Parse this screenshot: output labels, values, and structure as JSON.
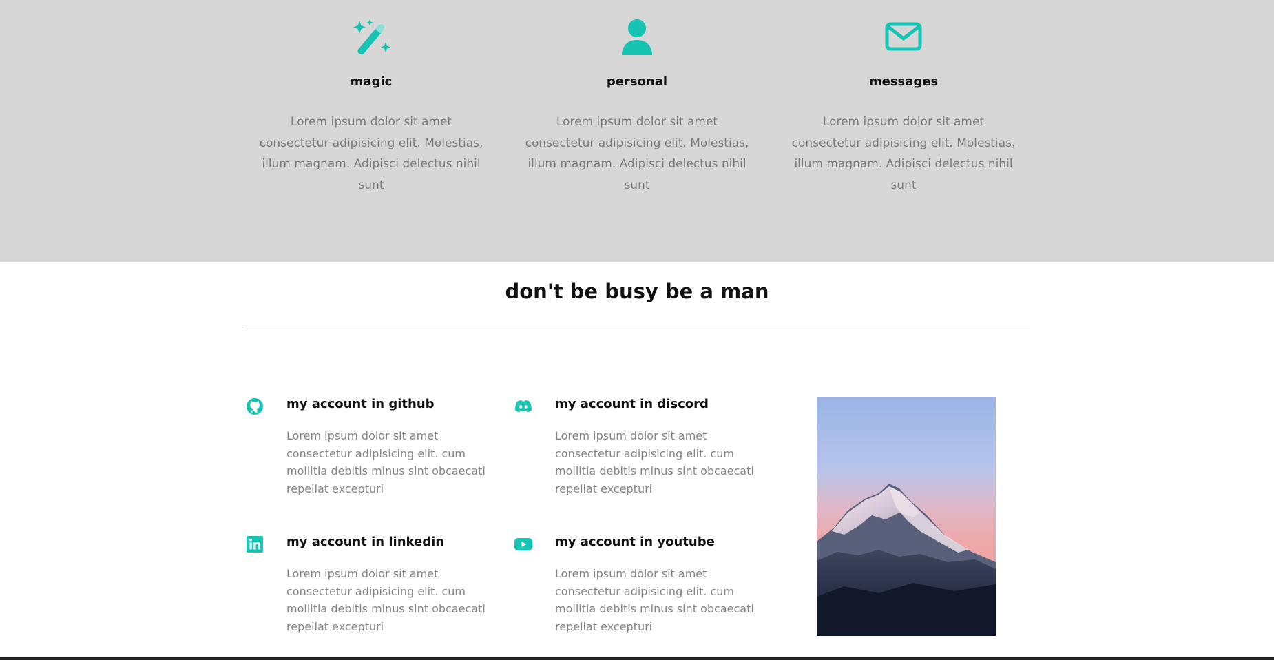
{
  "features": [
    {
      "icon": "magic-wand-icon",
      "title": "magic",
      "text": "Lorem ipsum dolor sit amet consectetur adipisicing elit. Molestias, illum magnam. Adipisci delectus nihil sunt"
    },
    {
      "icon": "user-icon",
      "title": "personal",
      "text": "Lorem ipsum dolor sit amet consectetur adipisicing elit. Molestias, illum magnam. Adipisci delectus nihil sunt"
    },
    {
      "icon": "envelope-icon",
      "title": "messages",
      "text": "Lorem ipsum dolor sit amet consectetur adipisicing elit. Molestias, illum magnam. Adipisci delectus nihil sunt"
    }
  ],
  "section2": {
    "title": "don't be busy be a man"
  },
  "accounts": [
    {
      "icon": "github-icon",
      "title": "my account in github",
      "text": "Lorem ipsum dolor sit amet consectetur adipisicing elit. cum mollitia debitis minus sint obcaecati repellat excepturi"
    },
    {
      "icon": "discord-icon",
      "title": "my account in discord",
      "text": "Lorem ipsum dolor sit amet consectetur adipisicing elit. cum mollitia debitis minus sint obcaecati repellat excepturi"
    },
    {
      "icon": "linkedin-icon",
      "title": "my account in linkedin",
      "text": "Lorem ipsum dolor sit amet consectetur adipisicing elit. cum mollitia debitis minus sint obcaecati repellat excepturi"
    },
    {
      "icon": "youtube-icon",
      "title": "my account in youtube",
      "text": "Lorem ipsum dolor sit amet consectetur adipisicing elit. cum mollitia debitis minus sint obcaecati repellat excepturi"
    }
  ],
  "photo": {
    "subject": "snowy-mountain-peak-image"
  },
  "colors": {
    "accent": "#17c3b2",
    "features_bg": "#d7d7d7",
    "heading": "#111111",
    "body_text": "#7d7d7d"
  }
}
